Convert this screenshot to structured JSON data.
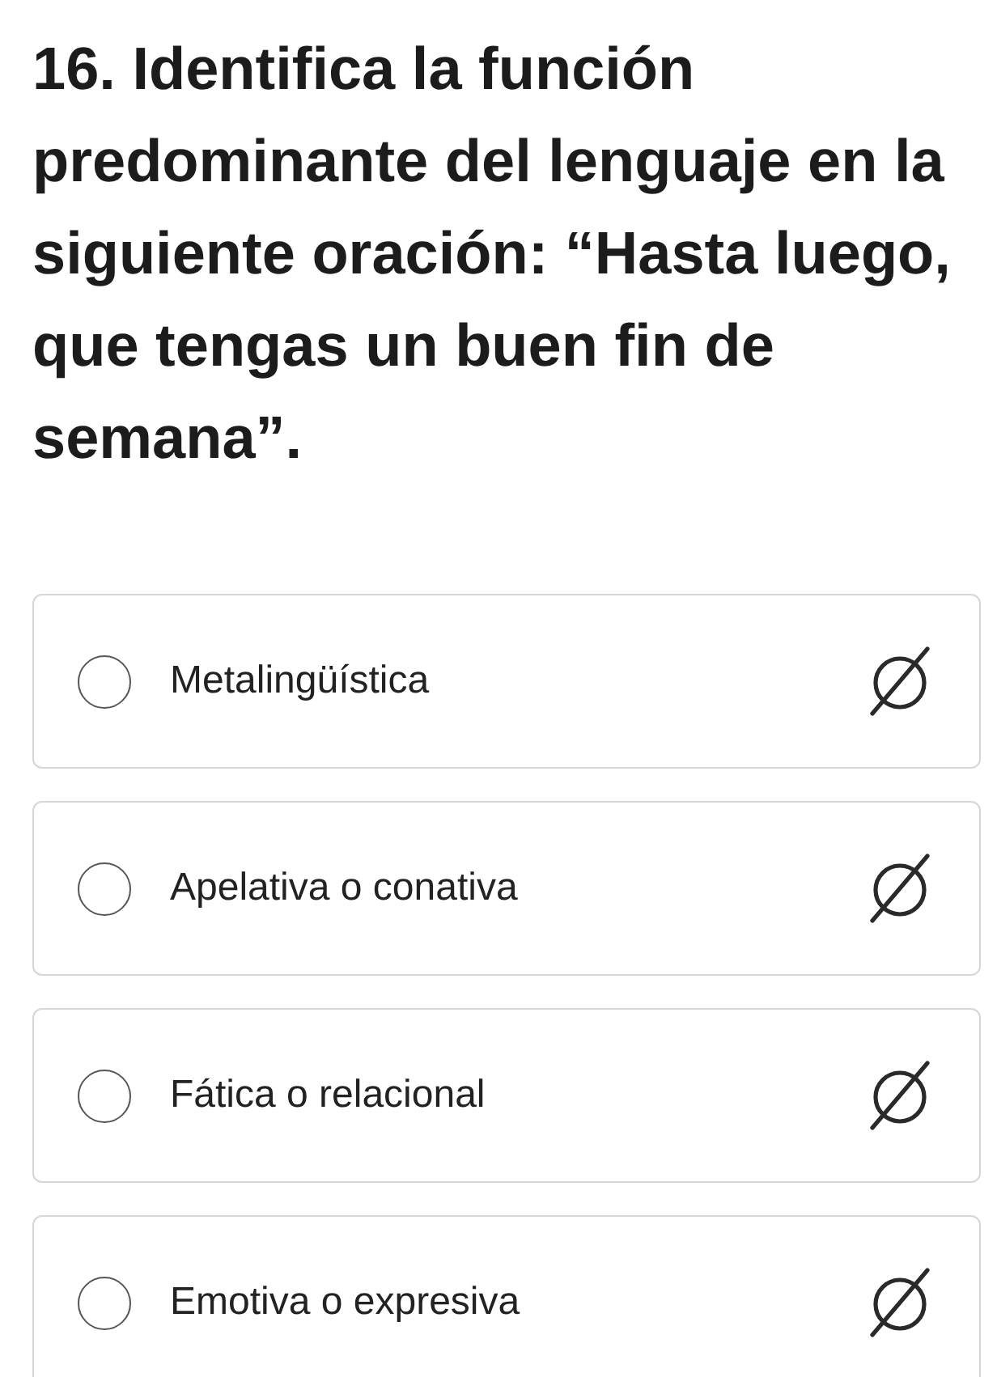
{
  "question": "16. Identifica la función predominante del lenguaje en la siguiente oración: “Hasta luego, que tengas un buen fin de semana”.",
  "options": [
    {
      "label": "Metalingüística",
      "selected": false
    },
    {
      "label": "Apelativa o conativa",
      "selected": false
    },
    {
      "label": "Fática o relacional",
      "selected": false
    },
    {
      "label": "Emotiva o expresiva",
      "selected": false
    }
  ]
}
